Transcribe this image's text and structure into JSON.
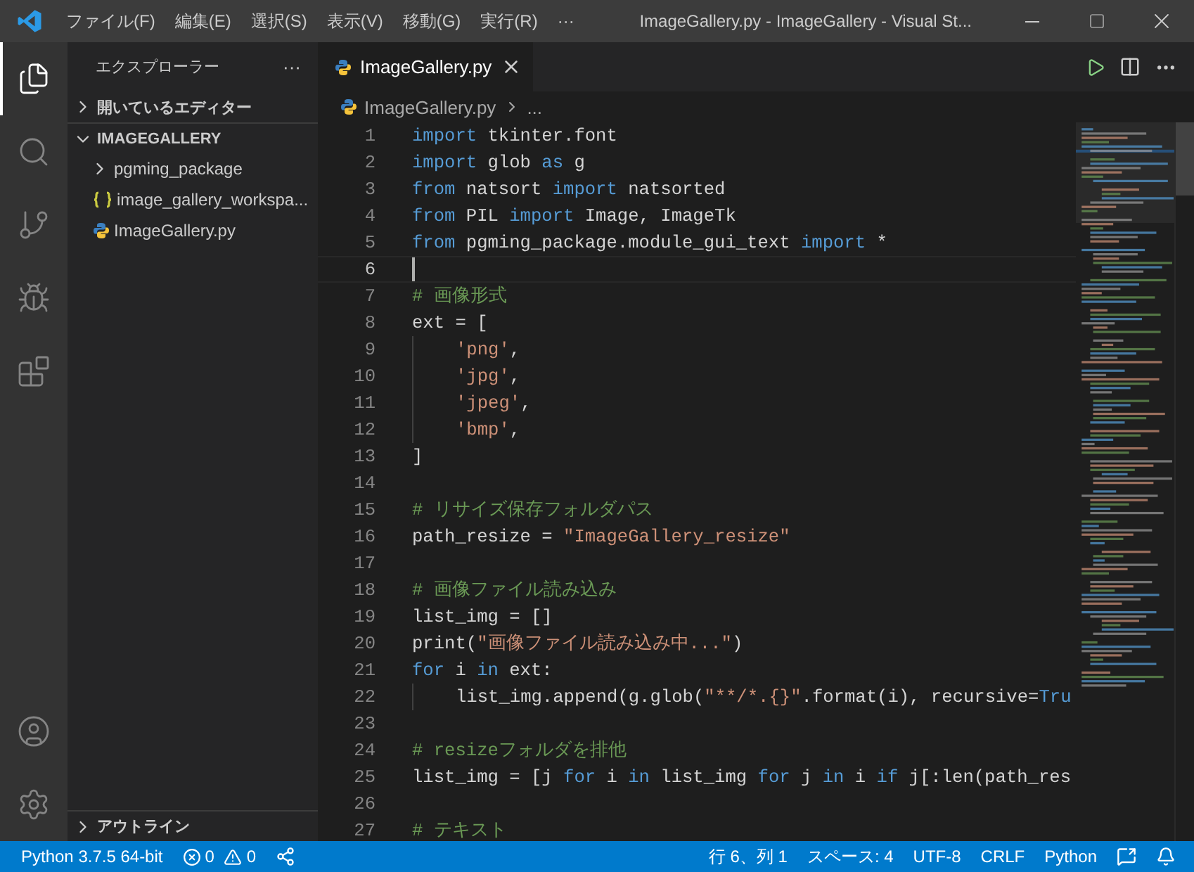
{
  "title_bar": {
    "menus": [
      "ファイル(F)",
      "編集(E)",
      "選択(S)",
      "表示(V)",
      "移動(G)",
      "実行(R)"
    ],
    "more": "···",
    "title": "ImageGallery.py - ImageGallery - Visual St..."
  },
  "activity_bar": [
    {
      "kind": "explorer",
      "selected": true
    },
    {
      "kind": "search",
      "selected": false
    },
    {
      "kind": "source-control",
      "selected": false
    },
    {
      "kind": "debug",
      "selected": false
    },
    {
      "kind": "extensions",
      "selected": false
    },
    {
      "kind": "account",
      "selected": false
    },
    {
      "kind": "settings",
      "selected": false
    }
  ],
  "sidebar": {
    "title": "エクスプローラー",
    "more": "···",
    "sections": [
      {
        "label": "開いているエディター",
        "expanded": false
      },
      {
        "label": "IMAGEGALLERY",
        "expanded": true,
        "children": [
          {
            "label": "pgming_package",
            "kind": "folder",
            "expanded": false
          },
          {
            "label": "image_gallery_workspa...",
            "kind": "json"
          },
          {
            "label": "ImageGallery.py",
            "kind": "python"
          }
        ]
      }
    ],
    "outline": {
      "label": "アウトライン",
      "expanded": false
    }
  },
  "tabs": [
    {
      "label": "ImageGallery.py",
      "selected": true
    }
  ],
  "breadcrumb": {
    "file": "ImageGallery.py",
    "rest": "..."
  },
  "editor": {
    "lines": [
      {
        "number": "1",
        "current": false,
        "indented": false,
        "tokens": [
          {
            "kind": "keyword",
            "text": "import"
          },
          {
            "kind": "plain",
            "text": " tkinter.font"
          }
        ]
      },
      {
        "number": "2",
        "current": false,
        "indented": false,
        "tokens": [
          {
            "kind": "keyword",
            "text": "import"
          },
          {
            "kind": "plain",
            "text": " glob "
          },
          {
            "kind": "keyword",
            "text": "as"
          },
          {
            "kind": "plain",
            "text": " g"
          }
        ]
      },
      {
        "number": "3",
        "current": false,
        "indented": false,
        "tokens": [
          {
            "kind": "keyword",
            "text": "from"
          },
          {
            "kind": "plain",
            "text": " natsort "
          },
          {
            "kind": "keyword",
            "text": "import"
          },
          {
            "kind": "plain",
            "text": " natsorted"
          }
        ]
      },
      {
        "number": "4",
        "current": false,
        "indented": false,
        "tokens": [
          {
            "kind": "keyword",
            "text": "from"
          },
          {
            "kind": "plain",
            "text": " PIL "
          },
          {
            "kind": "keyword",
            "text": "import"
          },
          {
            "kind": "plain",
            "text": " Image, ImageTk"
          }
        ]
      },
      {
        "number": "5",
        "current": false,
        "indented": false,
        "tokens": [
          {
            "kind": "keyword",
            "text": "from"
          },
          {
            "kind": "plain",
            "text": " pgming_package.module_gui_text "
          },
          {
            "kind": "keyword",
            "text": "import"
          },
          {
            "kind": "plain",
            "text": " *"
          }
        ]
      },
      {
        "number": "6",
        "current": true,
        "indented": false
      },
      {
        "number": "7",
        "current": false,
        "indented": false,
        "tokens": [
          {
            "kind": "comment",
            "text": "# 画像形式"
          }
        ]
      },
      {
        "number": "8",
        "current": false,
        "indented": false,
        "tokens": [
          {
            "kind": "plain",
            "text": "ext = ["
          }
        ]
      },
      {
        "number": "9",
        "current": false,
        "indented": true,
        "tokens": [
          {
            "kind": "string",
            "text": "'png'"
          },
          {
            "kind": "plain",
            "text": ","
          }
        ]
      },
      {
        "number": "10",
        "current": false,
        "indented": true,
        "tokens": [
          {
            "kind": "string",
            "text": "'jpg'"
          },
          {
            "kind": "plain",
            "text": ","
          }
        ]
      },
      {
        "number": "11",
        "current": false,
        "indented": true,
        "tokens": [
          {
            "kind": "string",
            "text": "'jpeg'"
          },
          {
            "kind": "plain",
            "text": ","
          }
        ]
      },
      {
        "number": "12",
        "current": false,
        "indented": true,
        "tokens": [
          {
            "kind": "string",
            "text": "'bmp'"
          },
          {
            "kind": "plain",
            "text": ","
          }
        ]
      },
      {
        "number": "13",
        "current": false,
        "indented": false,
        "tokens": [
          {
            "kind": "plain",
            "text": "]"
          }
        ]
      },
      {
        "number": "14",
        "current": false,
        "indented": false
      },
      {
        "number": "15",
        "current": false,
        "indented": false,
        "tokens": [
          {
            "kind": "comment",
            "text": "# リサイズ保存フォルダパス"
          }
        ]
      },
      {
        "number": "16",
        "current": false,
        "indented": false,
        "tokens": [
          {
            "kind": "plain",
            "text": "path_resize = "
          },
          {
            "kind": "string",
            "text": "\"ImageGallery_resize\""
          }
        ]
      },
      {
        "number": "17",
        "current": false,
        "indented": false
      },
      {
        "number": "18",
        "current": false,
        "indented": false,
        "tokens": [
          {
            "kind": "comment",
            "text": "# 画像ファイル読み込み"
          }
        ]
      },
      {
        "number": "19",
        "current": false,
        "indented": false,
        "tokens": [
          {
            "kind": "plain",
            "text": "list_img = []"
          }
        ]
      },
      {
        "number": "20",
        "current": false,
        "indented": false,
        "tokens": [
          {
            "kind": "plain",
            "text": "print("
          },
          {
            "kind": "string",
            "text": "\"画像ファイル読み込み中...\""
          },
          {
            "kind": "plain",
            "text": ")"
          }
        ]
      },
      {
        "number": "21",
        "current": false,
        "indented": false,
        "tokens": [
          {
            "kind": "keyword",
            "text": "for"
          },
          {
            "kind": "plain",
            "text": " i "
          },
          {
            "kind": "keyword",
            "text": "in"
          },
          {
            "kind": "plain",
            "text": " ext:"
          }
        ]
      },
      {
        "number": "22",
        "current": false,
        "indented": true,
        "tokens": [
          {
            "kind": "plain",
            "text": "list_img.append(g.glob("
          },
          {
            "kind": "string",
            "text": "\"**/*.{}\""
          },
          {
            "kind": "plain",
            "text": ".format(i), recursive="
          },
          {
            "kind": "keyword",
            "text": "Tru"
          }
        ]
      },
      {
        "number": "23",
        "current": false,
        "indented": false
      },
      {
        "number": "24",
        "current": false,
        "indented": false,
        "tokens": [
          {
            "kind": "comment",
            "text": "# resizeフォルダを排他"
          }
        ]
      },
      {
        "number": "25",
        "current": false,
        "indented": false,
        "tokens": [
          {
            "kind": "plain",
            "text": "list_img = [j "
          },
          {
            "kind": "keyword",
            "text": "for"
          },
          {
            "kind": "plain",
            "text": " i "
          },
          {
            "kind": "keyword",
            "text": "in"
          },
          {
            "kind": "plain",
            "text": " list_img "
          },
          {
            "kind": "keyword",
            "text": "for"
          },
          {
            "kind": "plain",
            "text": " j "
          },
          {
            "kind": "keyword",
            "text": "in"
          },
          {
            "kind": "plain",
            "text": " i "
          },
          {
            "kind": "keyword",
            "text": "if"
          },
          {
            "kind": "plain",
            "text": " j[:len(path_res"
          }
        ]
      },
      {
        "number": "26",
        "current": false,
        "indented": false
      },
      {
        "number": "27",
        "current": false,
        "indented": false,
        "tokens": [
          {
            "kind": "comment",
            "text": "# テキスト"
          }
        ]
      }
    ]
  },
  "status_bar": {
    "left": [
      {
        "kind": "text",
        "text": "Python 3.7.5 64-bit"
      },
      {
        "kind": "problems",
        "errors": "0",
        "warnings": "0"
      },
      {
        "kind": "liveshare"
      }
    ],
    "right": [
      {
        "kind": "text",
        "text": "行 6、列 1"
      },
      {
        "kind": "text",
        "text": "スペース: 4"
      },
      {
        "kind": "text",
        "text": "UTF-8"
      },
      {
        "kind": "text",
        "text": "CRLF"
      },
      {
        "kind": "text",
        "text": "Python"
      },
      {
        "kind": "feedback"
      },
      {
        "kind": "bell"
      }
    ]
  }
}
